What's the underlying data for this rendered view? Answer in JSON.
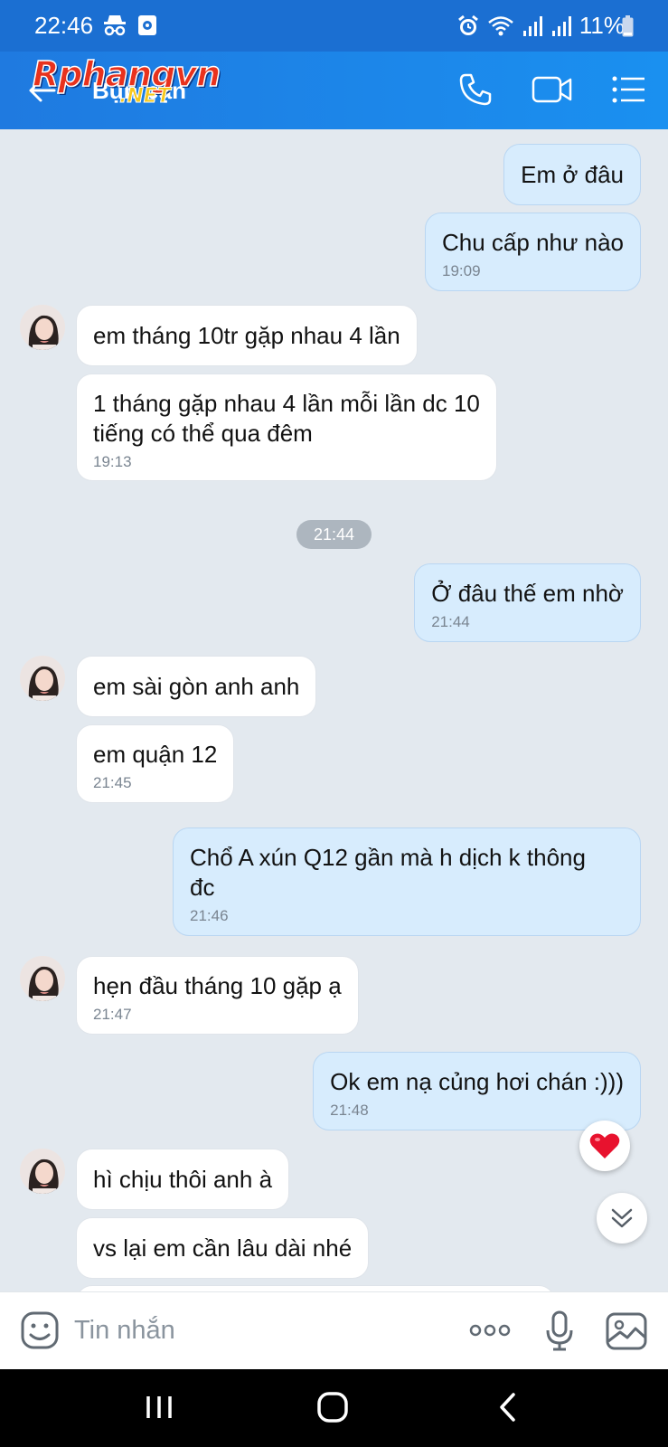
{
  "status_bar": {
    "time": "22:46",
    "battery": "11%",
    "icons": [
      "incognito-icon",
      "media-icon",
      "alarm-icon",
      "wifi-icon",
      "signal-icon",
      "signal-icon",
      "battery-icon"
    ]
  },
  "header": {
    "title": "Bụn bạn",
    "watermark_main": "Rphangvn",
    "watermark_sub": ".NET",
    "icons": [
      "back-arrow-icon",
      "phone-icon",
      "video-call-icon",
      "menu-list-icon"
    ]
  },
  "messages": [
    {
      "dir": "out",
      "text": "Em ở đâu",
      "time": ""
    },
    {
      "dir": "out",
      "text": "Chu cấp như nào",
      "time": "19:09"
    },
    {
      "dir": "in",
      "text": "em tháng 10tr gặp nhau 4 lần",
      "time": ""
    },
    {
      "dir": "in",
      "text": "1 tháng gặp nhau 4 lần mỗi lần dc 10",
      "text2": "tiếng có thể qua đêm",
      "time": "19:13"
    },
    {
      "dir": "out",
      "text": "Ở đâu thế em nhờ",
      "time": "21:44"
    },
    {
      "dir": "in",
      "text": "em sài gòn anh anh",
      "time": ""
    },
    {
      "dir": "in",
      "text": "em quận 12",
      "time": "21:45"
    },
    {
      "dir": "out",
      "text": "Chổ A xún Q12 gần mà h dịch k thông",
      "text2": "đc",
      "time": "21:46"
    },
    {
      "dir": "in",
      "text": "hẹn đầu tháng 10 gặp ạ",
      "time": "21:47"
    },
    {
      "dir": "out",
      "text": "Ok em nạ củng hơi chán :)))",
      "time": "21:48"
    },
    {
      "dir": "in",
      "text": "hì chịu thôi anh à",
      "time": ""
    },
    {
      "dir": "in",
      "text": "vs lại em cần lâu dài nhé",
      "time": ""
    }
  ],
  "time_divider": "21:44",
  "reaction": "heart-icon",
  "input": {
    "placeholder": "Tin nhắn"
  },
  "colors": {
    "header_blue": "#1b6fd2",
    "bubble_out": "#d7ecfd",
    "bubble_in": "#ffffff",
    "chat_bg": "#e3e9ef",
    "heart": "#e8122e"
  }
}
